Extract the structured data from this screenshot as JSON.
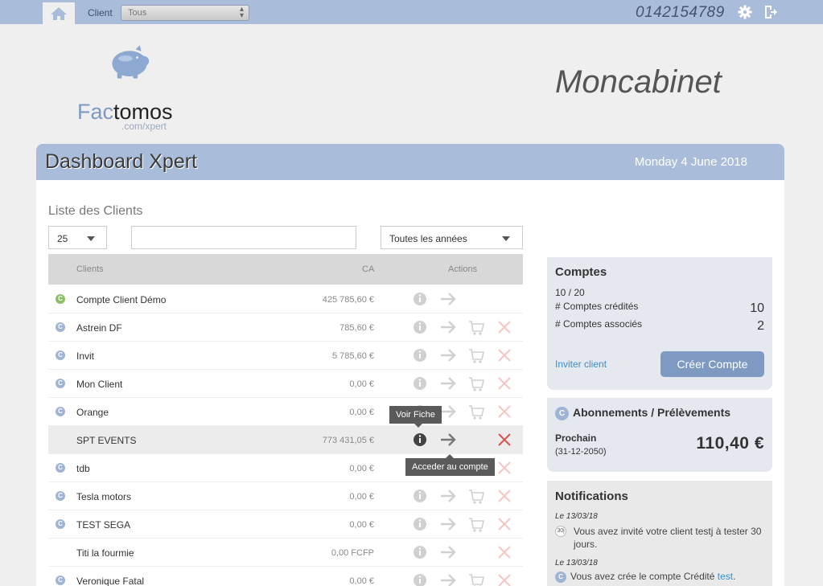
{
  "topbar": {
    "client_label": "Client",
    "client_select_value": "Tous",
    "phone": "0142154789"
  },
  "logo": {
    "name_part1": "Fac",
    "name_part2": "tomos",
    "subtitle": ".com/xpert"
  },
  "cabinet_name": "Moncabinet",
  "header": {
    "title": "Dashboard Xpert",
    "date": "Monday 4 June 2018"
  },
  "clients_list": {
    "title": "Liste des Clients",
    "page_size": "25",
    "search_value": "",
    "year_filter": "Toutes les années",
    "columns": {
      "clients": "Clients",
      "ca": "CA",
      "actions": "Actions"
    },
    "rows": [
      {
        "badge": "C",
        "name": "Compte Client Démo",
        "ca": "425 785,60 €"
      },
      {
        "badge": "C",
        "name": "Astrein DF",
        "ca": "785,60 €"
      },
      {
        "badge": "C",
        "name": "Invit",
        "ca": "5 785,60 €"
      },
      {
        "badge": "C",
        "name": "Mon Client",
        "ca": "0,00 €"
      },
      {
        "badge": "C",
        "name": "Orange",
        "ca": "0,00 €"
      },
      {
        "badge": "",
        "name": "SPT EVENTS",
        "ca": "773 431,05 €"
      },
      {
        "badge": "C",
        "name": "tdb",
        "ca": "0,00 €"
      },
      {
        "badge": "C",
        "name": "Tesla motors",
        "ca": "0,00 €"
      },
      {
        "badge": "C",
        "name": "TEST SEGA",
        "ca": "0,00 €"
      },
      {
        "badge": "",
        "name": "Titi la fourmie",
        "ca": "0,00 FCFP"
      },
      {
        "badge": "C",
        "name": "Veronique Fatal",
        "ca": "0,00 €"
      }
    ],
    "tooltip_info": "Voir Fiche",
    "tooltip_access": "Acceder au compte"
  },
  "accounts_card": {
    "title": "Comptes",
    "ratio": "10 / 20",
    "credited_label": "# Comptes crédités",
    "credited_value": "10",
    "associated_label": "# Comptes associés",
    "associated_value": "2",
    "invite_link": "Inviter client",
    "create_button": "Créer Compte"
  },
  "subscriptions_card": {
    "badge": "C",
    "title": "Abonnements / Prélèvements",
    "next_label": "Prochain",
    "next_date": "(31-12-2050)",
    "amount": "110,40 €"
  },
  "notifications": {
    "title": "Notifications",
    "items": [
      {
        "date": "Le 13/03/18",
        "icon": "30j",
        "text": "Vous avez invité votre client testj à tester 30 jours.",
        "link": ""
      },
      {
        "date": "Le 13/03/18",
        "icon": "C",
        "text": "Vous avez crée le compte Crédité ",
        "link": "test",
        "suffix": "."
      }
    ]
  },
  "colors": {
    "brand_blue": "#a9bcd9",
    "button_blue": "#7e9ac2",
    "delete_red": "#d9534f",
    "badge_green": "#8cbf68"
  }
}
